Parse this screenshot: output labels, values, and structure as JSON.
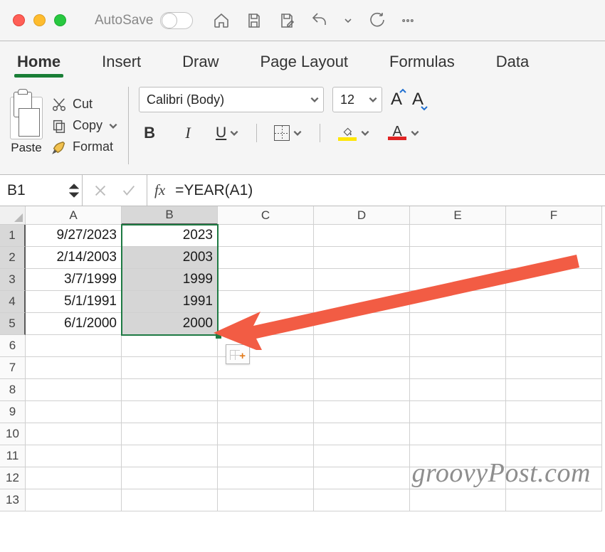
{
  "chrome": {
    "autosave_label": "AutoSave"
  },
  "tabs": [
    "Home",
    "Insert",
    "Draw",
    "Page Layout",
    "Formulas",
    "Data"
  ],
  "active_tab": 0,
  "clipboard": {
    "paste": "Paste",
    "cut": "Cut",
    "copy": "Copy",
    "format": "Format"
  },
  "font": {
    "name": "Calibri (Body)",
    "size": "12"
  },
  "fx": {
    "namebox": "B1",
    "fx_glyph": "fx",
    "formula": "=YEAR(A1)"
  },
  "columns": [
    "A",
    "B",
    "C",
    "D",
    "E",
    "F"
  ],
  "rows": [
    "1",
    "2",
    "3",
    "4",
    "5",
    "6",
    "7",
    "8",
    "9",
    "10",
    "11",
    "12",
    "13"
  ],
  "cells": {
    "A1": "9/27/2023",
    "B1": "2023",
    "A2": "2/14/2003",
    "B2": "2003",
    "A3": "3/7/1999",
    "B3": "1999",
    "A4": "5/1/1991",
    "B4": "1991",
    "A5": "6/1/2000",
    "B5": "2000"
  },
  "watermark": "groovyPost.com"
}
